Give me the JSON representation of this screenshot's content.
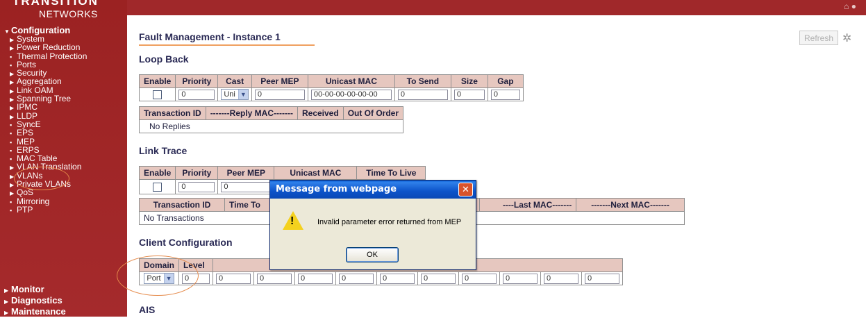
{
  "brand": {
    "top_text": "TRANSITION",
    "name": "NETWORKS",
    "registered": "."
  },
  "nav": {
    "configuration": "Configuration",
    "items": [
      {
        "label": "System",
        "marker": "▶"
      },
      {
        "label": "Power Reduction",
        "marker": "▶"
      },
      {
        "label": "Thermal Protection",
        "marker": "▪"
      },
      {
        "label": "Ports",
        "marker": "▪"
      },
      {
        "label": "Security",
        "marker": "▶"
      },
      {
        "label": "Aggregation",
        "marker": "▶"
      },
      {
        "label": "Link OAM",
        "marker": "▶"
      },
      {
        "label": "Spanning Tree",
        "marker": "▶"
      },
      {
        "label": "IPMC",
        "marker": "▶"
      },
      {
        "label": "LLDP",
        "marker": "▶"
      },
      {
        "label": "SyncE",
        "marker": "▪"
      },
      {
        "label": "EPS",
        "marker": "▪"
      },
      {
        "label": "MEP",
        "marker": "▪"
      },
      {
        "label": "ERPS",
        "marker": "▪"
      },
      {
        "label": "MAC Table",
        "marker": "▪"
      },
      {
        "label": "VLAN Translation",
        "marker": "▶"
      },
      {
        "label": "VLANs",
        "marker": "▶"
      },
      {
        "label": "Private VLANs",
        "marker": "▶"
      },
      {
        "label": "QoS",
        "marker": "▶"
      },
      {
        "label": "Mirroring",
        "marker": "▪"
      },
      {
        "label": "PTP",
        "marker": "▪"
      }
    ],
    "monitor": "Monitor",
    "diagnostics": "Diagnostics",
    "maintenance": "Maintenance"
  },
  "page": {
    "title": "Fault Management - Instance 1",
    "refresh_label": "Refresh"
  },
  "loopback": {
    "heading": "Loop Back",
    "headers": [
      "Enable",
      "Priority",
      "Cast",
      "Peer MEP",
      "Unicast MAC",
      "To Send",
      "Size",
      "Gap"
    ],
    "values": {
      "priority": "0",
      "cast": "Uni",
      "peer_mep": "0",
      "unicast_mac": "00-00-00-00-00-00",
      "to_send": "0",
      "size": "0",
      "gap": "0"
    },
    "reply_headers": [
      "Transaction ID",
      "-------Reply MAC-------",
      "Received",
      "Out Of Order"
    ],
    "no_replies": "No Replies"
  },
  "linktrace": {
    "heading": "Link Trace",
    "headers": [
      "Enable",
      "Priority",
      "Peer MEP",
      "Unicast MAC",
      "Time To Live"
    ],
    "values": {
      "priority": "0",
      "peer_mep": "0"
    },
    "tx_headers": [
      "Transaction ID",
      "Time To",
      "----Last MAC-------",
      "-------Next MAC-------"
    ],
    "no_transactions": "No Transactions"
  },
  "client": {
    "heading": "Client Configuration",
    "headers": [
      "Domain",
      "Level"
    ],
    "domain_value": "Port",
    "level_values": [
      "0",
      "0",
      "0",
      "0",
      "0",
      "0",
      "0",
      "0",
      "0",
      "0",
      "0"
    ]
  },
  "ais": {
    "heading": "AIS"
  },
  "dialog": {
    "title": "Message from webpage",
    "close": "✕",
    "message": "Invalid parameter error returned from MEP",
    "ok_label": "OK"
  },
  "colors": {
    "nav_bg": "#a0282a",
    "table_header": "#e6c7bf",
    "title_underline": "#f0a060",
    "dialog_title": "#0c53c9",
    "annotation": "#e58a4a"
  }
}
